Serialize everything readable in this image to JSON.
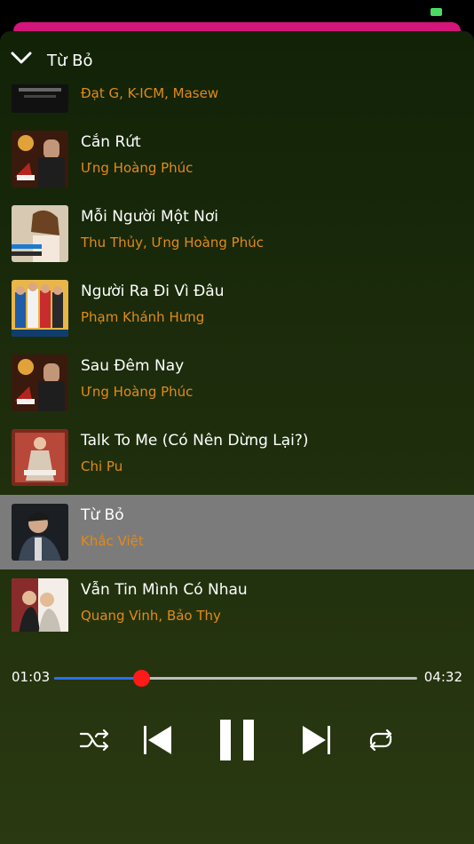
{
  "header": {
    "title": "Từ Bỏ"
  },
  "songs": [
    {
      "title": "",
      "artist": "Đạt G, K-ICM, Masew"
    },
    {
      "title": "Cắn Rứt",
      "artist": "Ưng Hoàng Phúc"
    },
    {
      "title": "Mỗi Người Một Nơi",
      "artist": "Thu Thủy, Ưng Hoàng Phúc"
    },
    {
      "title": "Người Ra Đi Vì Đâu",
      "artist": "Phạm Khánh Hưng"
    },
    {
      "title": "Sau Đêm Nay",
      "artist": "Ưng Hoàng Phúc"
    },
    {
      "title": "Talk To Me (Có Nên Dừng Lại?)",
      "artist": "Chi Pu"
    },
    {
      "title": "Từ Bỏ",
      "artist": "Khắc Việt"
    },
    {
      "title": "Vẫn Tin Mình Có Nhau",
      "artist": "Quang Vinh, Bảo Thy"
    }
  ],
  "active_index": 6,
  "player": {
    "current_time": "01:03",
    "total_time": "04:32",
    "progress": 0.24
  },
  "colors": {
    "accent": "#e28a18",
    "progress_fill": "#2a6ff0",
    "knob": "#ff1a1a",
    "active_row": "#7b7b7b",
    "top_sheet": "#d4157a"
  },
  "icons": [
    "chevron-down-icon",
    "shuffle-icon",
    "previous-icon",
    "pause-icon",
    "next-icon",
    "repeat-icon"
  ]
}
